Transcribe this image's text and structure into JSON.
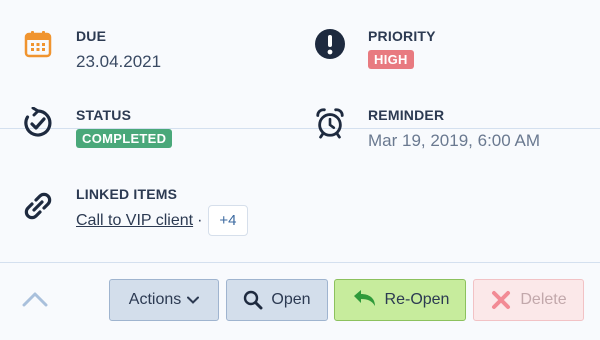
{
  "fields": {
    "due": {
      "label": "DUE",
      "value": "23.04.2021",
      "icon": "calendar-icon"
    },
    "priority": {
      "label": "PRIORITY",
      "value": "HIGH",
      "badge_color": "#e87a80",
      "icon": "exclamation-circle-icon"
    },
    "status": {
      "label": "STATUS",
      "value": "COMPLETED",
      "badge_color": "#4aa87a",
      "icon": "status-check-icon"
    },
    "reminder": {
      "label": "REMINDER",
      "value": "Mar 19, 2019, 6:00 AM",
      "icon": "alarm-clock-icon"
    },
    "linked": {
      "label": "LINKED ITEMS",
      "link": "Call to VIP client",
      "separator": "·",
      "more": "+4",
      "icon": "link-icon"
    }
  },
  "footer": {
    "actions_label": "Actions",
    "open_label": "Open",
    "reopen_label": "Re-Open",
    "delete_label": "Delete"
  },
  "colors": {
    "accent": "#3c6aa0",
    "calendar_icon": "#f0942f",
    "dark_icon": "#1e2a3f",
    "reopen_green": "#2f9a3a",
    "delete_red": "#f28b95"
  }
}
